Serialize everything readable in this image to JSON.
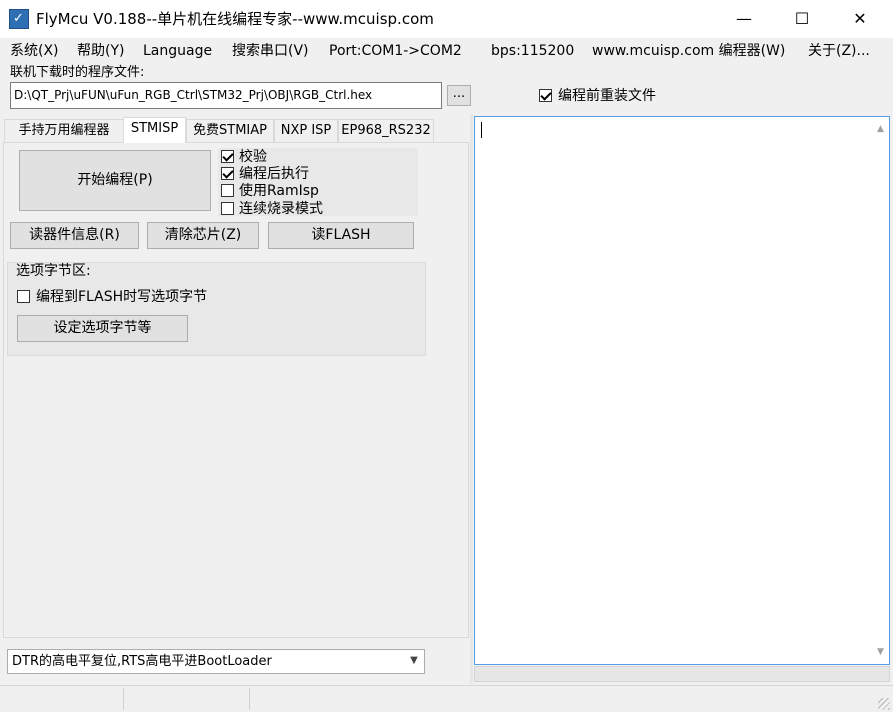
{
  "window": {
    "title": "FlyMcu V0.188--单片机在线编程专家--www.mcuisp.com",
    "icon": "app-logo-icon",
    "controls": {
      "minimize": "—",
      "maximize": "☐",
      "close": "✕"
    }
  },
  "menu": [
    "系统(X)",
    "帮助(Y)",
    "Language",
    "搜索串口(V)",
    "Port:COM1->COM2",
    "bps:115200",
    "www.mcuisp.com 编程器(W)",
    "关于(Z)..."
  ],
  "file": {
    "label": "联机下载时的程序文件:",
    "path": "D:\\QT_Prj\\uFUN\\uFun_RGB_Ctrl\\STM32_Prj\\OBJ\\RGB_Ctrl.hex",
    "browse": "...",
    "reload_label": "编程前重装文件",
    "reload_checked": true
  },
  "tabs": [
    "手持万用编程器",
    "STMISP",
    "免费STMIAP",
    "NXP ISP",
    "EP968_RS232"
  ],
  "stmisp": {
    "start_button": "开始编程(P)",
    "options": [
      {
        "label": "校验",
        "checked": true
      },
      {
        "label": "编程后执行",
        "checked": true
      },
      {
        "label": "使用RamIsp",
        "checked": false
      },
      {
        "label": "连续烧录模式",
        "checked": false
      }
    ],
    "read_info": "读器件信息(R)",
    "erase": "清除芯片(Z)",
    "read_flash": "读FLASH",
    "option_group": {
      "title": "选项字节区:",
      "write_option_label": "编程到FLASH时写选项字节",
      "write_option_checked": false,
      "set_button": "设定选项字节等"
    }
  },
  "bootloader_select": {
    "value": "DTR的高电平复位,RTS高电平进BootLoader"
  },
  "log": {
    "text": ""
  },
  "colors": {
    "field_border": "#7a7a7a",
    "focus_border": "#569de5",
    "button_bg": "#e1e1e1",
    "app_icon": "#2f6fb3"
  }
}
